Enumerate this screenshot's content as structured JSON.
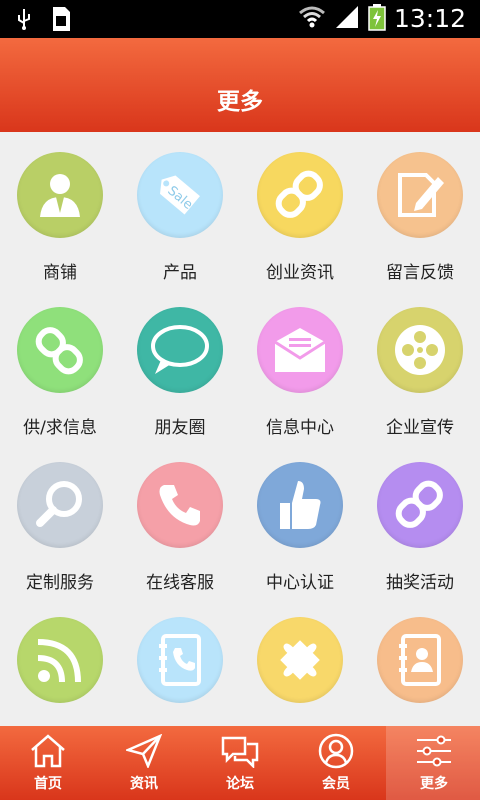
{
  "status_bar": {
    "time": "13:12"
  },
  "header": {
    "title": "更多"
  },
  "grid": {
    "items": [
      {
        "label": "商铺",
        "icon": "person-icon",
        "color": "#b9cf66"
      },
      {
        "label": "产品",
        "icon": "sale-tag-icon",
        "color": "#b8e4fb"
      },
      {
        "label": "创业资讯",
        "icon": "link-icon",
        "color": "#f7d85f"
      },
      {
        "label": "留言反馈",
        "icon": "edit-icon",
        "color": "#f6c28e"
      },
      {
        "label": "供/求信息",
        "icon": "link-icon",
        "color": "#8fe07b"
      },
      {
        "label": "朋友圈",
        "icon": "chat-bubble-icon",
        "color": "#3fb7a5"
      },
      {
        "label": "信息中心",
        "icon": "mail-icon",
        "color": "#f29bea"
      },
      {
        "label": "企业宣传",
        "icon": "film-reel-icon",
        "color": "#d7d36d"
      },
      {
        "label": "定制服务",
        "icon": "magnifier-icon",
        "color": "#c8d0da"
      },
      {
        "label": "在线客服",
        "icon": "phone-icon",
        "color": "#f5a0a8"
      },
      {
        "label": "中心认证",
        "icon": "thumbs-up-icon",
        "color": "#7fa8d9"
      },
      {
        "label": "抽奖活动",
        "icon": "link-icon",
        "color": "#b58df0"
      },
      {
        "label": "",
        "icon": "rss-icon",
        "color": "#b7d76b"
      },
      {
        "label": "",
        "icon": "phonebook-icon",
        "color": "#b9e4fb"
      },
      {
        "label": "",
        "icon": "puzzle-icon",
        "color": "#f8d86a"
      },
      {
        "label": "",
        "icon": "contacts-icon",
        "color": "#f7bd8b"
      }
    ]
  },
  "nav": {
    "items": [
      {
        "label": "首页",
        "icon": "home-icon"
      },
      {
        "label": "资讯",
        "icon": "send-icon"
      },
      {
        "label": "论坛",
        "icon": "chat-icon"
      },
      {
        "label": "会员",
        "icon": "user-icon"
      },
      {
        "label": "更多",
        "icon": "settings-sliders-icon",
        "active": true
      }
    ]
  }
}
